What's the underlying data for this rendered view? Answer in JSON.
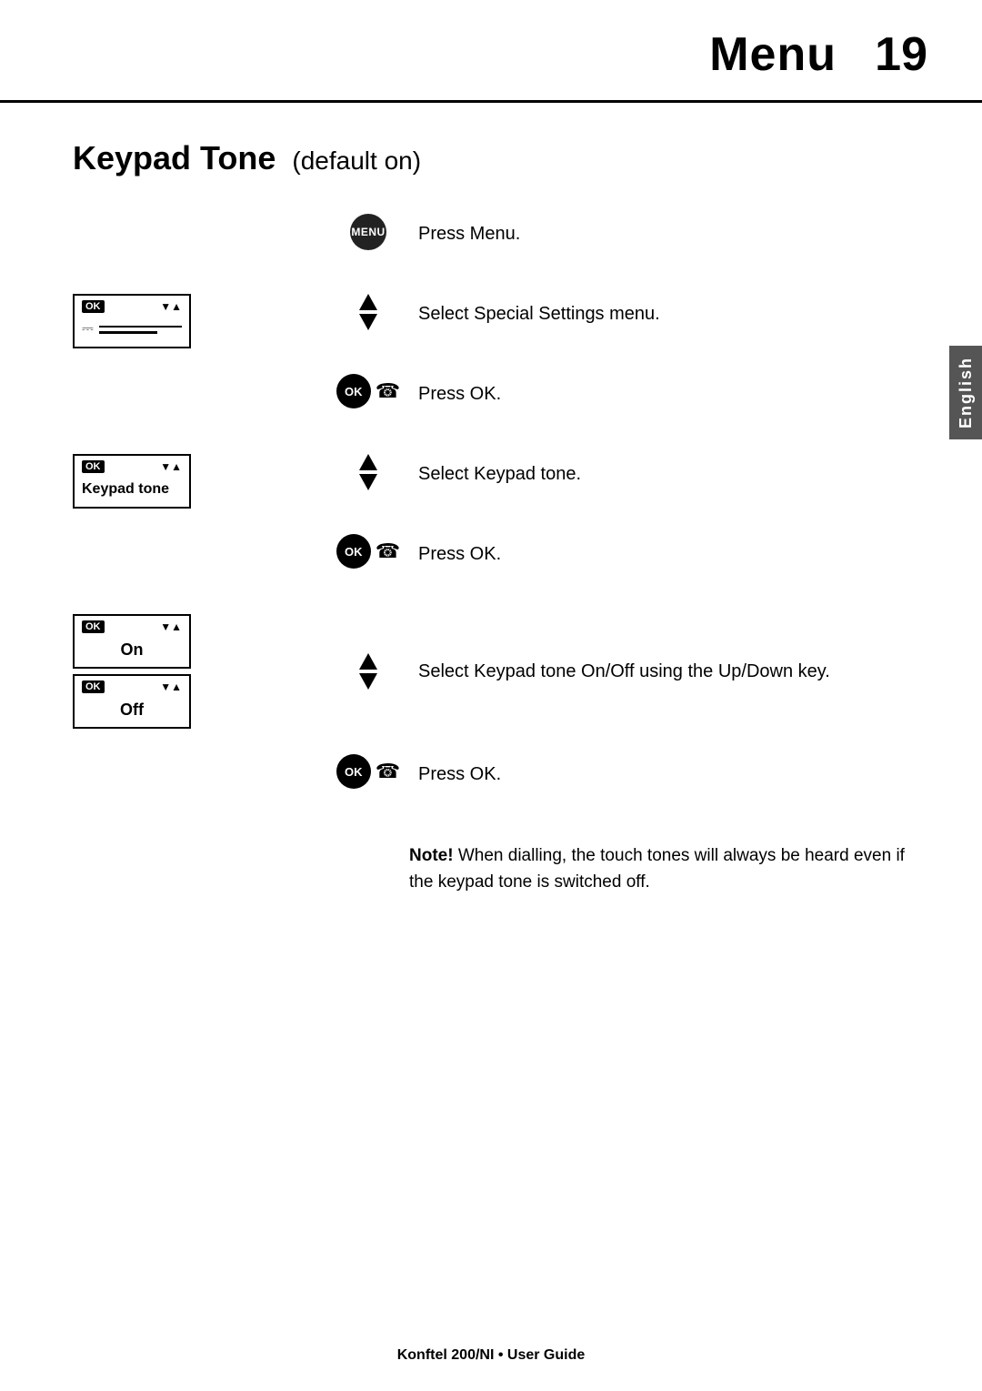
{
  "header": {
    "title": "Menu",
    "page_number": "19"
  },
  "english_tab": "English",
  "section": {
    "title": "Keypad Tone",
    "subtitle": "(default on)"
  },
  "steps": [
    {
      "id": "step1",
      "screen": "menu_button",
      "nav": "none",
      "instruction": "Press Menu."
    },
    {
      "id": "step2",
      "screen": "special_settings",
      "nav": "arrows",
      "instruction": "Select Special Settings menu."
    },
    {
      "id": "step3",
      "screen": "none",
      "nav": "ok",
      "instruction": "Press OK."
    },
    {
      "id": "step4",
      "screen": "keypad_tone",
      "nav": "arrows",
      "instruction": "Select Keypad tone."
    },
    {
      "id": "step5",
      "screen": "none",
      "nav": "ok",
      "instruction": "Press OK."
    },
    {
      "id": "step6",
      "screen": "on_off",
      "nav": "arrows",
      "instruction": "Select Keypad tone On/Off using the Up/Down key."
    },
    {
      "id": "step7",
      "screen": "none",
      "nav": "ok",
      "instruction": "Press OK."
    }
  ],
  "note": {
    "bold_part": "Note!",
    "text": " When dialling, the touch tones will always be heard even if the keypad tone is switched off."
  },
  "screens": {
    "on_label": "On",
    "off_label": "Off",
    "keypad_tone_label": "Keypad tone",
    "ok_label": "OK",
    "menu_label": "MENU"
  },
  "footer": {
    "text": "Konftel 200/NI • User Guide"
  }
}
